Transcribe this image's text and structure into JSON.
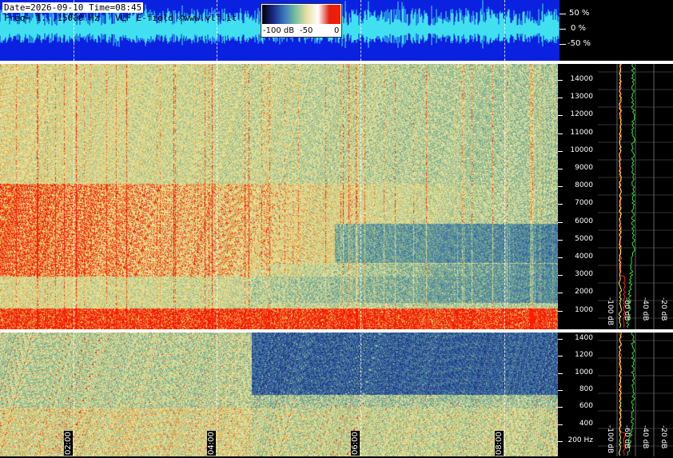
{
  "header": {
    "line1": "Date=2026-09-10 Time=08:45",
    "line2": "Freq= 1...15000 Hz   VLF E-field ©www.vlf.it"
  },
  "color_scale": {
    "ticks": [
      "-100 dB",
      "-50",
      "0"
    ],
    "colors": [
      "#000000",
      "#1a2a8a",
      "#3a7ac0",
      "#7ac0a0",
      "#e8e0a0",
      "#ffffff",
      "#e02010",
      "#ff1a00"
    ]
  },
  "waveform_axis": {
    "labels": [
      "50 %",
      "0 %",
      "-50 %"
    ]
  },
  "spectrogram_upper": {
    "freq_labels": [
      "14000",
      "13000",
      "12000",
      "11000",
      "10000",
      "9000",
      "8000",
      "7000",
      "6000",
      "5000",
      "4000",
      "3000",
      "2000",
      "1000"
    ],
    "profile_db_labels": [
      "-100 dB",
      "-60 dB",
      "-40 dB",
      "-20 dB"
    ]
  },
  "spectrogram_lower": {
    "freq_labels": [
      "1400",
      "1200",
      "1000",
      "800",
      "600",
      "400",
      "200 Hz"
    ],
    "profile_db_labels": [
      "-100 dB",
      "-60 dB",
      "-40 dB",
      "-20 dB"
    ]
  },
  "time_axis": {
    "labels": [
      "02:00",
      "04:00",
      "06:00",
      "08:00"
    ]
  },
  "colors": {
    "waveform_bg": "#0a22e0",
    "waveform_trace": "#40e0f0",
    "profile_red": "#ff2020",
    "profile_yellow": "#ffff40",
    "profile_green": "#30e030"
  }
}
